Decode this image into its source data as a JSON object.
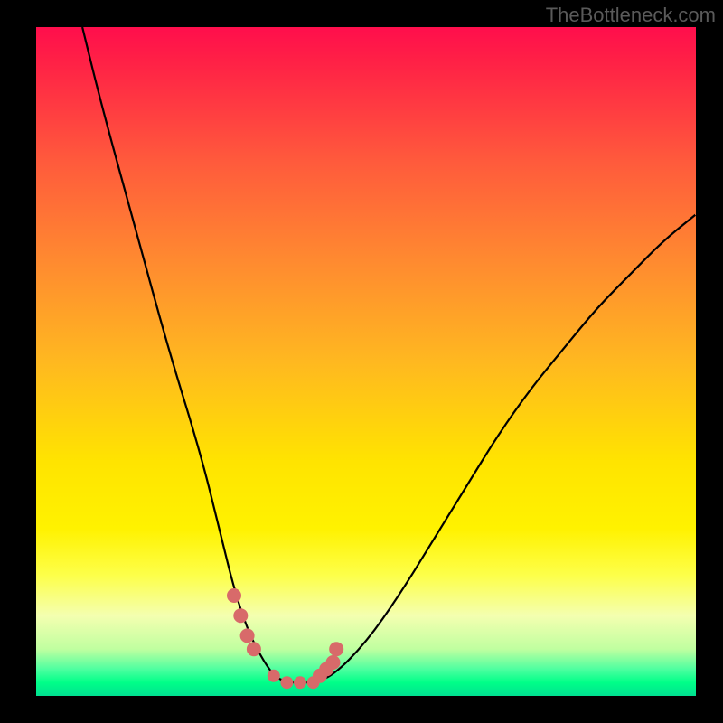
{
  "watermark": "TheBottleneck.com",
  "chart_data": {
    "type": "line",
    "title": "",
    "xlabel": "",
    "ylabel": "",
    "xlim": [
      0,
      100
    ],
    "ylim": [
      0,
      100
    ],
    "series": [
      {
        "name": "bottleneck-curve",
        "x": [
          7,
          10,
          15,
          20,
          25,
          28,
          30,
          32,
          34,
          36,
          38,
          40,
          42,
          45,
          50,
          55,
          60,
          65,
          70,
          75,
          80,
          85,
          90,
          95,
          100
        ],
        "y": [
          100,
          88,
          70,
          52,
          36,
          24,
          16,
          10,
          6,
          3,
          2,
          2,
          2,
          3,
          8,
          15,
          23,
          31,
          39,
          46,
          52,
          58,
          63,
          68,
          72
        ]
      }
    ],
    "markers": {
      "name": "highlight-points",
      "x": [
        30,
        31,
        32,
        33,
        36,
        38,
        40,
        42,
        43,
        44,
        45,
        45.5
      ],
      "y": [
        15,
        12,
        9,
        7,
        3,
        2,
        2,
        2,
        3,
        4,
        5,
        7
      ]
    },
    "gradient_background": {
      "top_color": "#ff0e4c",
      "bottom_color": "#00e090",
      "description": "vertical red-orange-yellow-green gradient"
    }
  }
}
